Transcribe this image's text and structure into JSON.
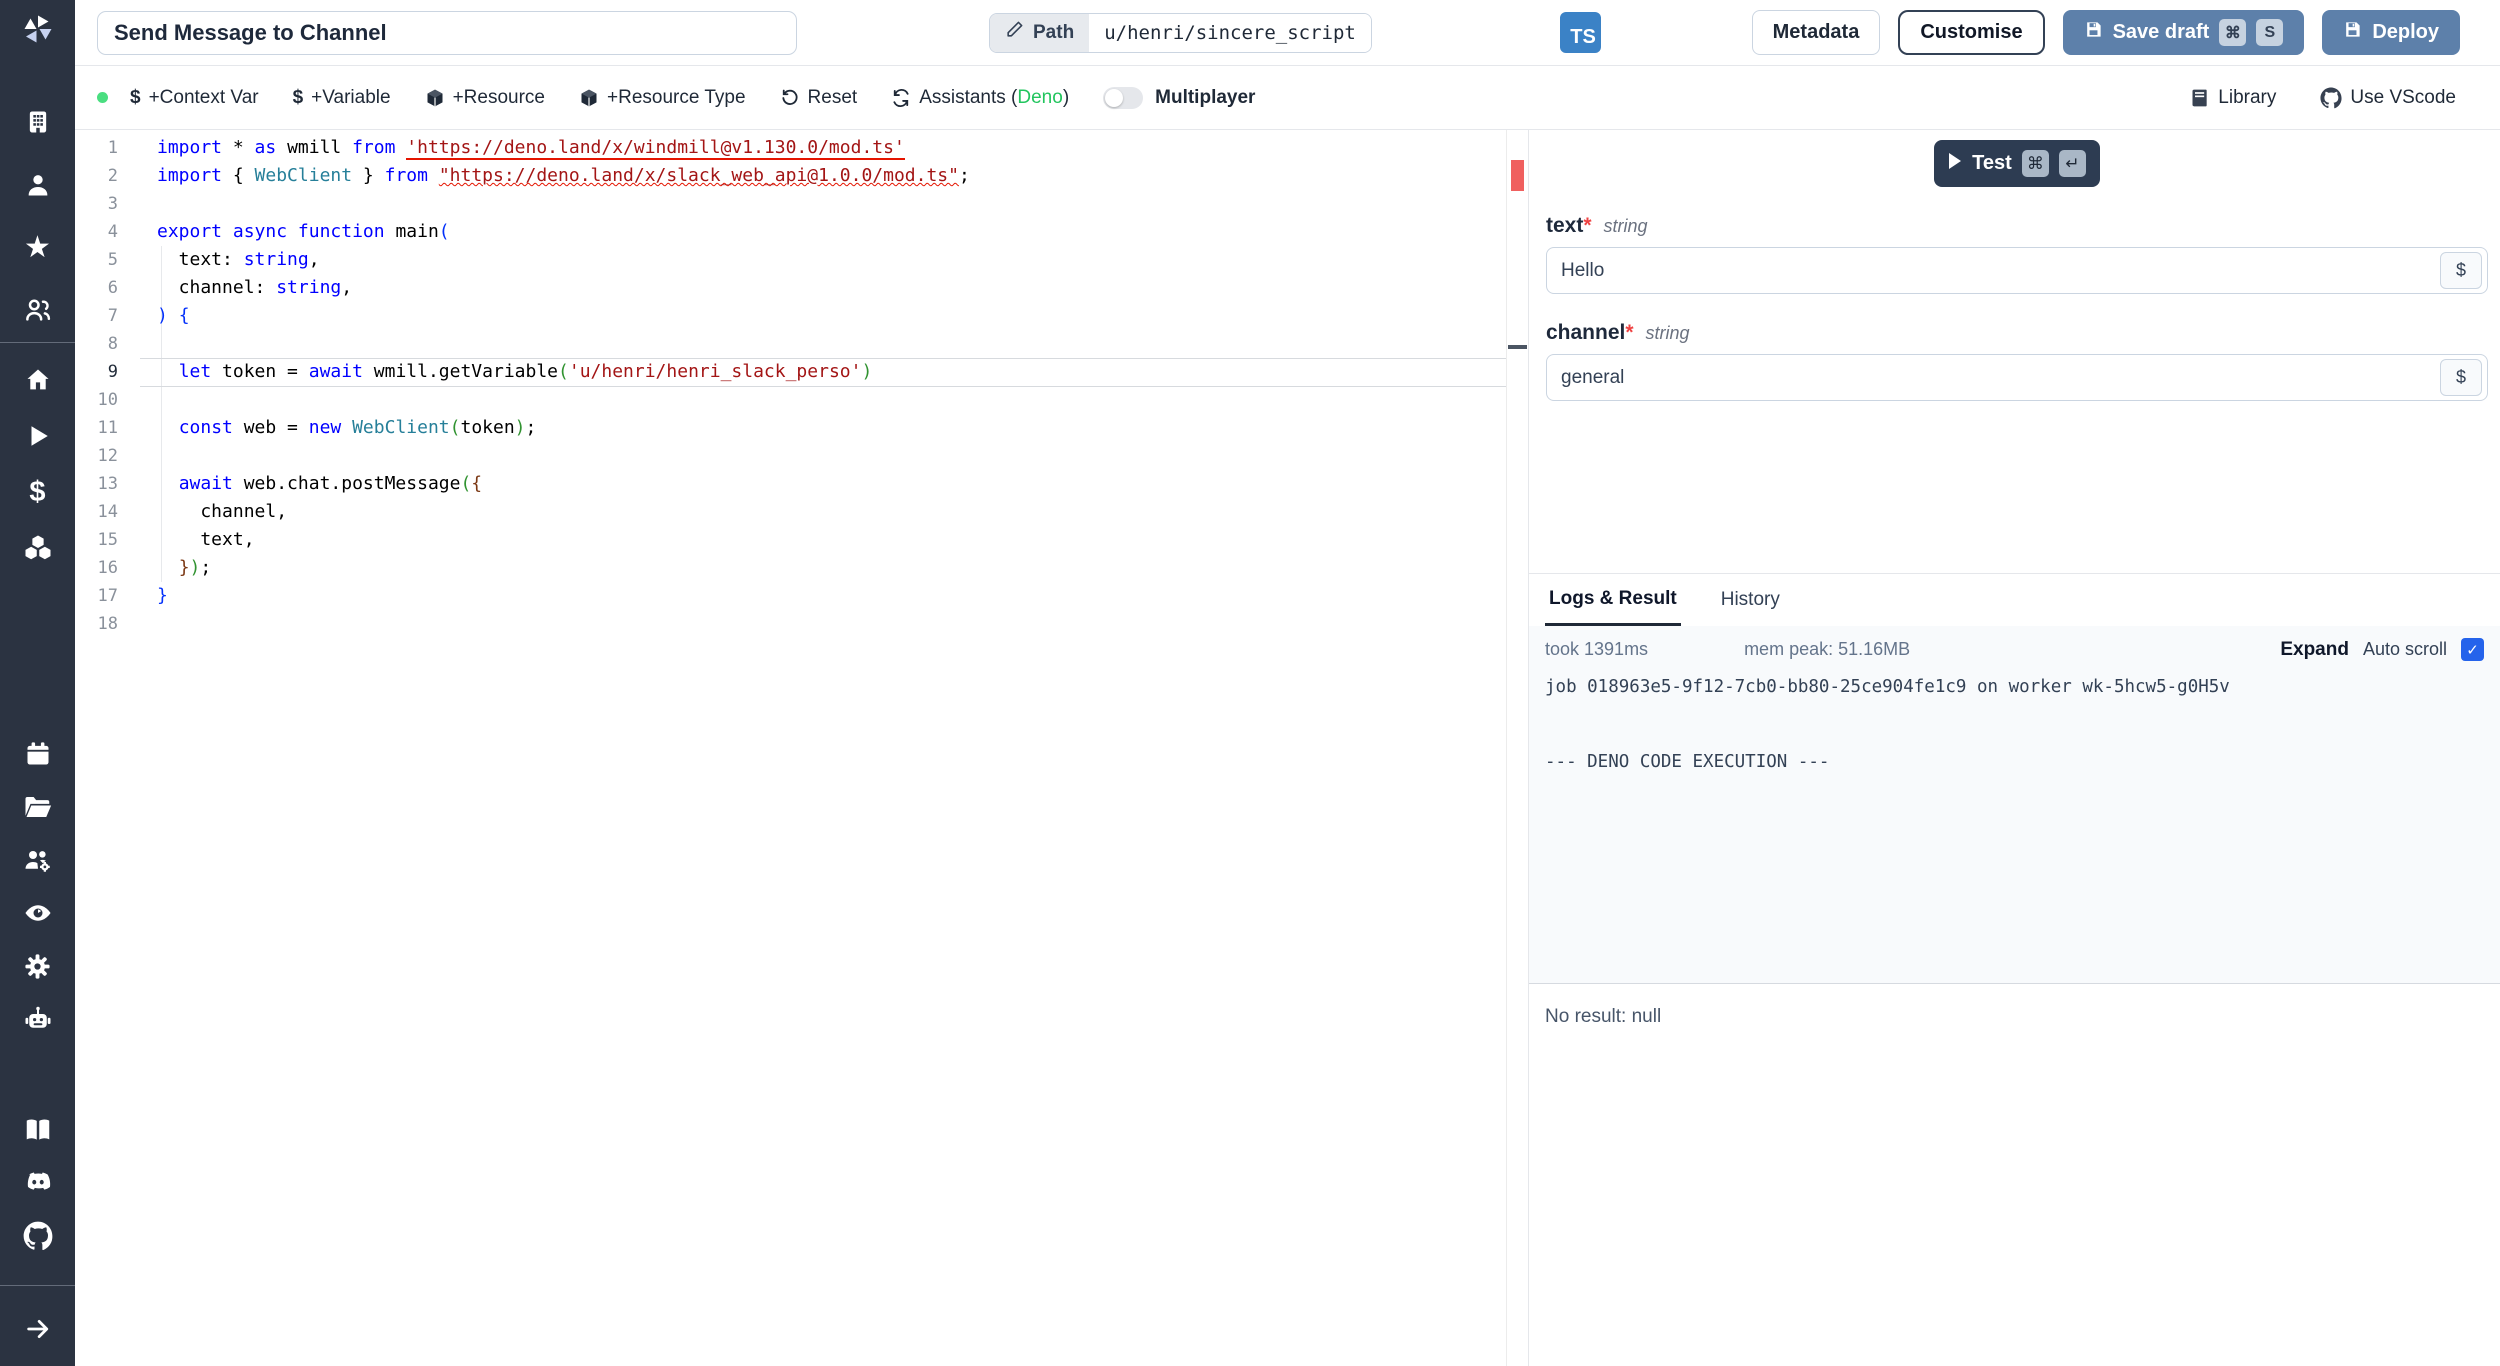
{
  "glyphs": {
    "dollar": "$",
    "command": "⌘",
    "enter": "↵",
    "check": "✓",
    "star": "★",
    "required": "*"
  },
  "colors": {
    "accent_blue": "#5d80aa",
    "ts_badge": "#3b82c6",
    "deno_green": "#22c55e",
    "checkbox_blue": "#2563eb",
    "status_green": "#4ade80",
    "error_red": "#e51400",
    "sidebar_bg": "#2b3341",
    "test_btn": "#2d3c52"
  },
  "sidebar": {
    "icons": [
      "windmill-logo",
      "workspace-building-icon",
      "user-icon",
      "favorites-star-icon",
      "users-icon",
      "home-icon",
      "runs-play-icon",
      "variables-dollar-icon",
      "resources-cubes-icon",
      "schedules-calendar-icon",
      "folders-icon",
      "groups-gear-icon",
      "audit-eye-icon",
      "settings-gear-icon",
      "workers-robot-icon",
      "docs-book-icon",
      "discord-icon",
      "github-icon",
      "expand-arrow-icon"
    ]
  },
  "topbar": {
    "title_value": "Send Message to Channel",
    "path_label": "Path",
    "path_value": "u/henri/sincere_script",
    "lang_badge": "TS",
    "metadata_label": "Metadata",
    "customise_label": "Customise",
    "save_draft_label": "Save draft",
    "save_kbd": [
      "⌘",
      "S"
    ],
    "deploy_label": "Deploy"
  },
  "toolbar": {
    "context_var": "+Context Var",
    "variable": "+Variable",
    "resource": "+Resource",
    "resource_type": "+Resource Type",
    "reset": "Reset",
    "assistants_prefix": "Assistants (",
    "assistants_lang": "Deno",
    "assistants_suffix": ")",
    "multiplayer": "Multiplayer",
    "library": "Library",
    "vscode": "Use VScode"
  },
  "editor": {
    "active_line": 9,
    "lines": [
      [
        [
          "k",
          "import"
        ],
        [
          "d",
          " * "
        ],
        [
          "k",
          "as"
        ],
        [
          "d",
          " wmill "
        ],
        [
          "k",
          "from"
        ],
        [
          "d",
          " "
        ],
        [
          "s u1",
          "'https://deno.land/x/windmill@v1.130.0/mod.ts'"
        ]
      ],
      [
        [
          "k",
          "import"
        ],
        [
          "d",
          " { "
        ],
        [
          "t",
          "WebClient"
        ],
        [
          "d",
          " } "
        ],
        [
          "k",
          "from"
        ],
        [
          "d",
          " "
        ],
        [
          "s u2",
          "\"https://deno.land/x/slack_web_api@1.0.0/mod.ts\""
        ],
        [
          "d",
          ";"
        ]
      ],
      [],
      [
        [
          "k",
          "export"
        ],
        [
          "d",
          " "
        ],
        [
          "k",
          "async"
        ],
        [
          "d",
          " "
        ],
        [
          "k",
          "function"
        ],
        [
          "d",
          " main"
        ],
        [
          "b1",
          "("
        ]
      ],
      [
        [
          "d",
          "  text: "
        ],
        [
          "k",
          "string"
        ],
        [
          "d",
          ","
        ]
      ],
      [
        [
          "d",
          "  channel: "
        ],
        [
          "k",
          "string"
        ],
        [
          "d",
          ","
        ]
      ],
      [
        [
          "b1",
          ")"
        ],
        [
          "d",
          " "
        ],
        [
          "b1",
          "{"
        ]
      ],
      [],
      [
        [
          "d",
          "  "
        ],
        [
          "k",
          "let"
        ],
        [
          "d",
          " token = "
        ],
        [
          "k",
          "await"
        ],
        [
          "d",
          " wmill.getVariable"
        ],
        [
          "b2",
          "("
        ],
        [
          "s",
          "'u/henri/henri_slack_perso'"
        ],
        [
          "b2",
          ")"
        ]
      ],
      [],
      [
        [
          "d",
          "  "
        ],
        [
          "k",
          "const"
        ],
        [
          "d",
          " web = "
        ],
        [
          "k",
          "new"
        ],
        [
          "d",
          " "
        ],
        [
          "t",
          "WebClient"
        ],
        [
          "b2",
          "("
        ],
        [
          "d",
          "token"
        ],
        [
          "b2",
          ")"
        ],
        [
          "d",
          ";"
        ]
      ],
      [],
      [
        [
          "d",
          "  "
        ],
        [
          "k",
          "await"
        ],
        [
          "d",
          " web.chat.postMessage"
        ],
        [
          "b2",
          "("
        ],
        [
          "b3",
          "{"
        ]
      ],
      [
        [
          "d",
          "    channel,"
        ]
      ],
      [
        [
          "d",
          "    text,"
        ]
      ],
      [
        [
          "d",
          "  "
        ],
        [
          "b3",
          "}"
        ],
        [
          "b2",
          ")"
        ],
        [
          "d",
          ";"
        ]
      ],
      [
        [
          "b1",
          "}"
        ]
      ],
      []
    ]
  },
  "form": {
    "test_label": "Test",
    "test_kbd": [
      "⌘",
      "↵"
    ],
    "fields": [
      {
        "name": "text",
        "type": "string",
        "value": "Hello"
      },
      {
        "name": "channel",
        "type": "string",
        "value": "general"
      }
    ]
  },
  "logs": {
    "tab_logs": "Logs & Result",
    "tab_history": "History",
    "took": "took 1391ms",
    "mem": "mem peak: 51.16MB",
    "expand": "Expand",
    "autoscroll": "Auto scroll",
    "lines": [
      "job 018963e5-9f12-7cb0-bb80-25ce904fe1c9 on worker wk-5hcw5-g0H5v",
      "",
      "",
      "--- DENO CODE EXECUTION ---"
    ],
    "result": "No result: null"
  }
}
